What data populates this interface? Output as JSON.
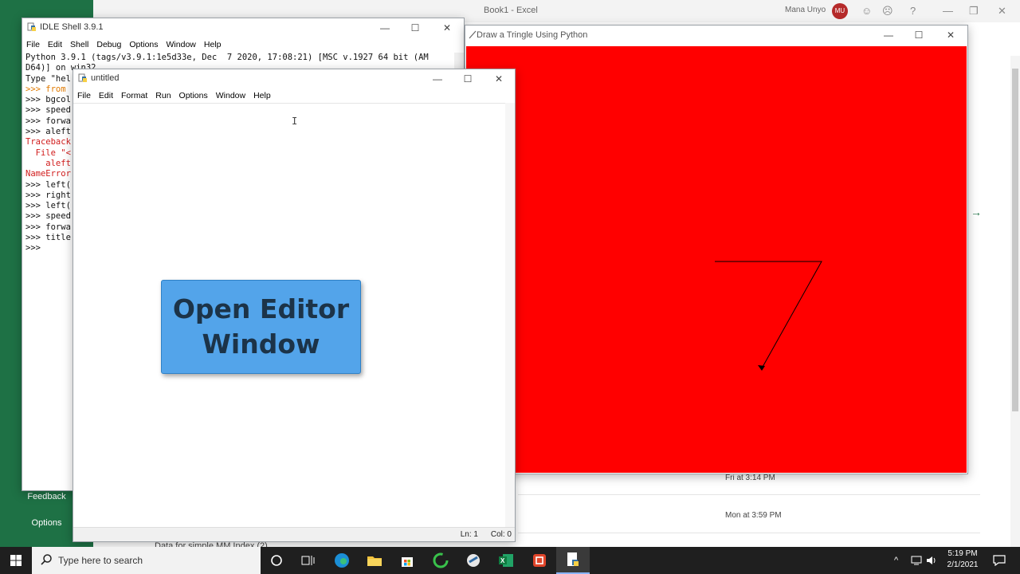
{
  "excel": {
    "title": "Book1  -  Excel",
    "user": "Mana Unyo",
    "avatar": "MU",
    "sidebar": {
      "feedback": "Feedback",
      "options": "Options"
    },
    "recent": [
      {
        "time": "Fri at 3:14 PM"
      },
      {
        "time": "Mon at 3:59 PM"
      }
    ],
    "file_name": "Data for simple MM Index (2)"
  },
  "shell": {
    "title": "IDLE Shell 3.9.1",
    "menu": [
      "File",
      "Edit",
      "Shell",
      "Debug",
      "Options",
      "Window",
      "Help"
    ],
    "lines": [
      {
        "text": "Python 3.9.1 (tags/v3.9.1:1e5d33e, Dec  7 2020, 17:08:21) [MSC v.1927 64 bit (AM",
        "color": "black"
      },
      {
        "text": "D64)] on win32",
        "color": "black"
      },
      {
        "text": "Type \"hel",
        "color": "black"
      },
      {
        "text": ">>> from",
        "color": "orange"
      },
      {
        "text": ">>> bgcol",
        "color": "black"
      },
      {
        "text": ">>> speed",
        "color": "black"
      },
      {
        "text": ">>> forwa",
        "color": "black"
      },
      {
        "text": ">>> aleft",
        "color": "black"
      },
      {
        "text": "Traceback",
        "color": "red"
      },
      {
        "text": "  File \"<",
        "color": "red"
      },
      {
        "text": "    aleft",
        "color": "red"
      },
      {
        "text": "NameError",
        "color": "red"
      },
      {
        "text": ">>> left(",
        "color": "black"
      },
      {
        "text": ">>> right",
        "color": "black"
      },
      {
        "text": ">>> left(",
        "color": "black"
      },
      {
        "text": ">>> speed",
        "color": "black"
      },
      {
        "text": ">>> forwa",
        "color": "black"
      },
      {
        "text": ">>> title",
        "color": "black"
      },
      {
        "text": ">>>",
        "color": "black"
      }
    ]
  },
  "turtle": {
    "title": "Draw a Tringle Using Python",
    "canvas_color": "#ff0000",
    "line_color": "#000000"
  },
  "editor": {
    "title": "untitled",
    "menu": [
      "File",
      "Edit",
      "Format",
      "Run",
      "Options",
      "Window",
      "Help"
    ],
    "status_ln": "Ln: 1",
    "status_col": "Col: 0"
  },
  "callout": {
    "line1": "Open Editor",
    "line2": "Window",
    "color": "#53a4ea"
  },
  "taskbar": {
    "search_placeholder": "Type here to search",
    "time": "5:19 PM",
    "date": "2/1/2021"
  }
}
